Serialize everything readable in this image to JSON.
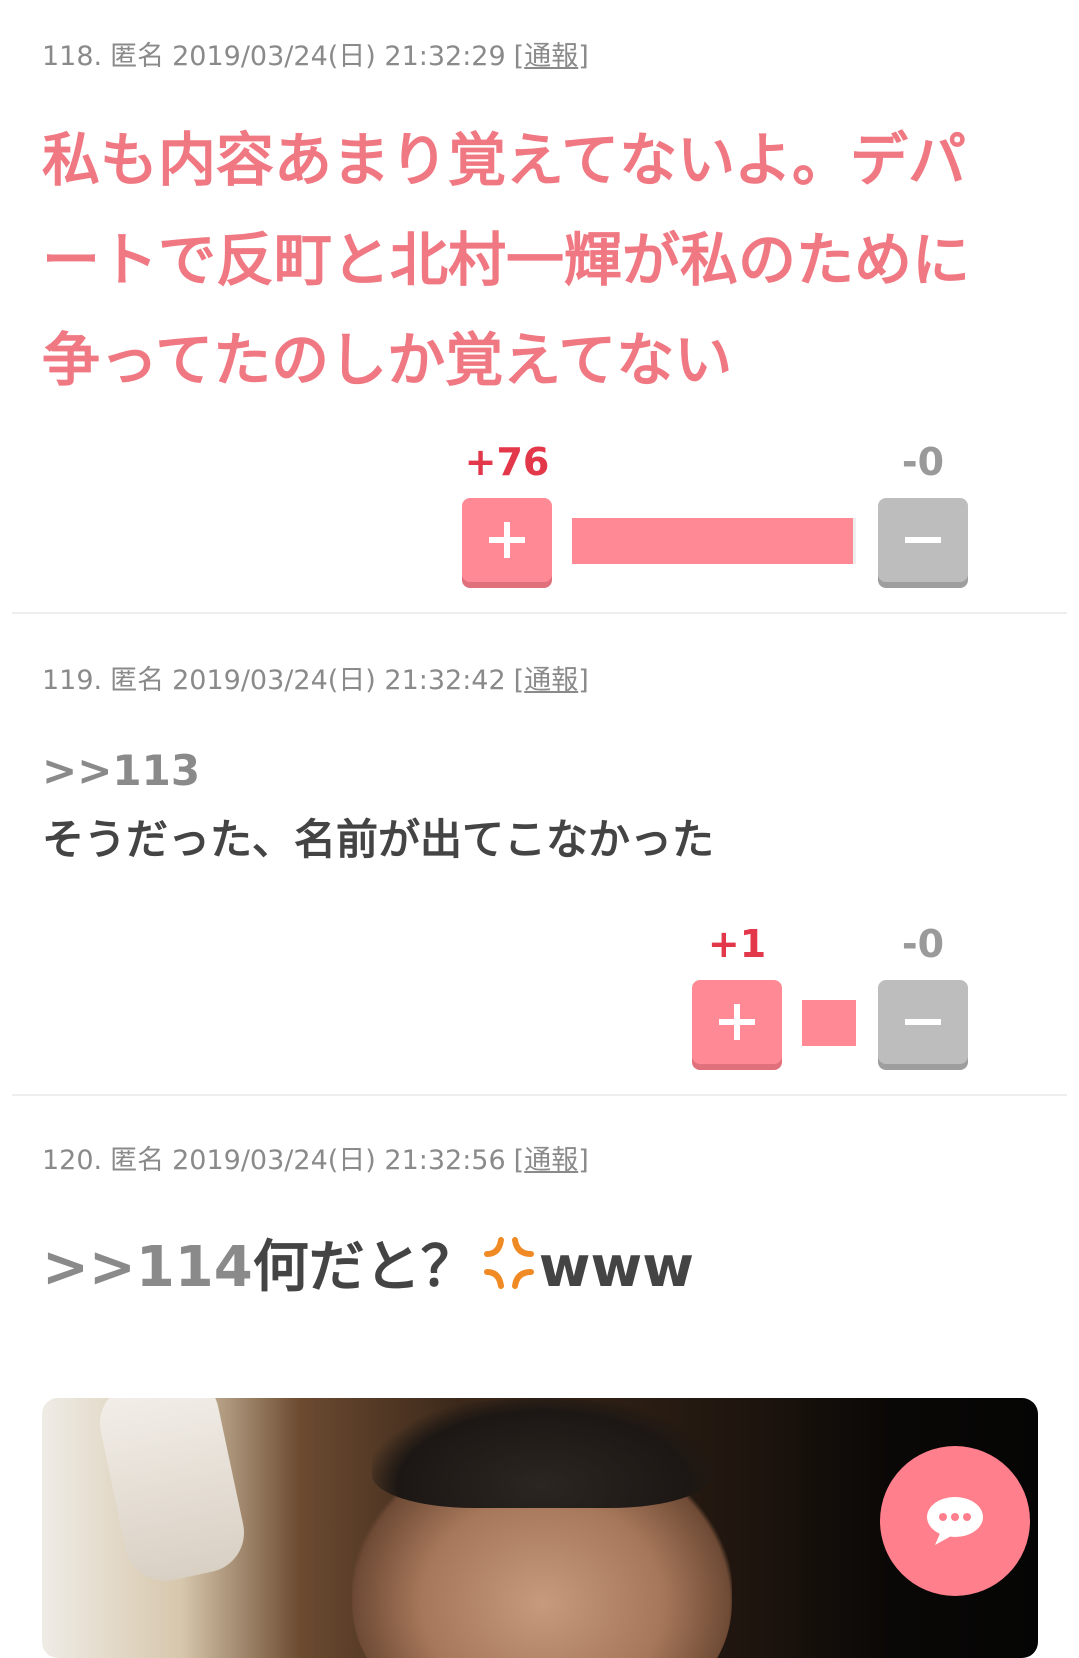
{
  "comments": [
    {
      "number": "118.",
      "name": "匿名",
      "date": "2019/03/24(日) 21:32:29",
      "report_open": "[",
      "report_label": "通報",
      "report_close": "]",
      "text": "私も内容あまり覚えてないよ。デパートで反町と北村一輝が私のために争ってたのしか覚えてない",
      "plus": "+76",
      "minus": "-0",
      "plus_ratio": 0.99
    },
    {
      "number": "119.",
      "name": "匿名",
      "date": "2019/03/24(日) 21:32:42",
      "report_open": "[",
      "report_label": "通報",
      "report_close": "]",
      "anchor": ">>113",
      "text": "そうだった、名前が出てこなかった",
      "plus": "+1",
      "minus": "-0",
      "plus_ratio": 1.0
    },
    {
      "number": "120.",
      "name": "匿名",
      "date": "2019/03/24(日) 21:32:56",
      "report_open": "[",
      "report_label": "通報",
      "report_close": "]",
      "anchor": ">>114",
      "text_before": "何だと？",
      "text_after": "www",
      "emoji": "anger-icon"
    }
  ],
  "colors": {
    "accent": "#ff8a96",
    "plus_count": "#e3384a",
    "pink_text": "#f07882",
    "minus_button": "#bdbdbd"
  },
  "fab_icon": "chat-bubble-icon"
}
